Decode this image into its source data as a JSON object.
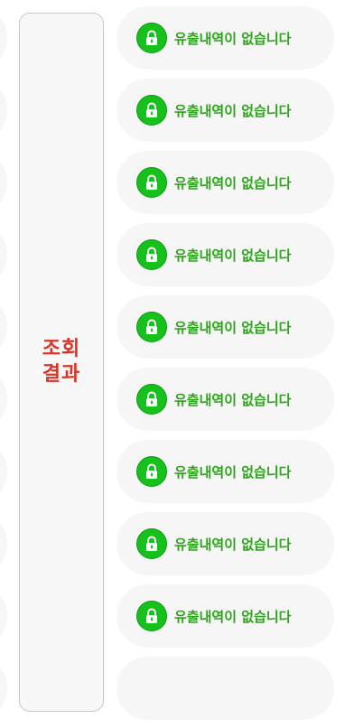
{
  "panel": {
    "label_line1": "조회",
    "label_line2": "결과"
  },
  "results": {
    "items": [
      {
        "text": "유출내역이 없습니다",
        "icon": "lock-icon"
      },
      {
        "text": "유출내역이 없습니다",
        "icon": "lock-icon"
      },
      {
        "text": "유출내역이 없습니다",
        "icon": "lock-icon"
      },
      {
        "text": "유출내역이 없습니다",
        "icon": "lock-icon"
      },
      {
        "text": "유출내역이 없습니다",
        "icon": "lock-icon"
      },
      {
        "text": "유출내역이 없습니다",
        "icon": "lock-icon"
      },
      {
        "text": "유출내역이 없습니다",
        "icon": "lock-icon"
      },
      {
        "text": "유출내역이 없습니다",
        "icon": "lock-icon"
      },
      {
        "text": "유출내역이 없습니다",
        "icon": "lock-icon"
      },
      {
        "text": "",
        "icon": ""
      }
    ]
  },
  "colors": {
    "label_red": "#d8362a",
    "status_green": "#2ba519",
    "badge_green": "#16c11b"
  }
}
